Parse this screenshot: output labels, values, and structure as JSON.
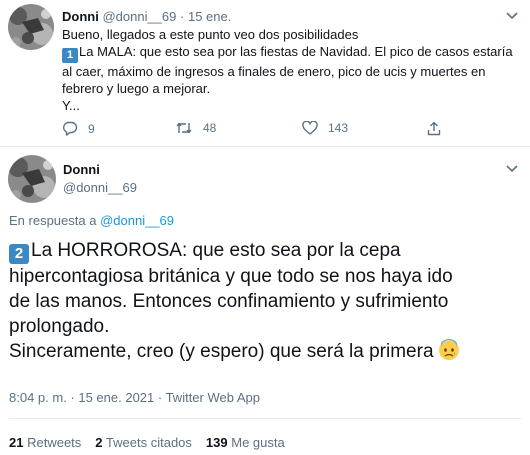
{
  "tweet1": {
    "author_name": "Donni",
    "handle": "@donni__69",
    "separator": "·",
    "date": "15 ene.",
    "lines": [
      "Bueno, llegados a este punto veo dos posibilidades",
      "La MALA: que esto sea por las fiestas de Navidad. El pico de casos estaría",
      "al caer, máximo de ingresos a finales de enero, pico de ucis y muertes en",
      "febrero y luego a mejorar.",
      "Y..."
    ],
    "keycap": "1",
    "replies": "9",
    "retweets": "48",
    "likes": "143"
  },
  "tweet2": {
    "author_name": "Donni",
    "handle": "@donni__69",
    "reply_prefix": "En respuesta a",
    "reply_to": "@donni__69",
    "keycap": "2",
    "lines": [
      "La HORROROSA: que esto sea por la cepa",
      "hipercontagiosa británica y que todo se nos haya ido",
      "de las manos. Entonces confinamiento y sufrimiento",
      "prolongado.",
      "Sinceramente, creo (y espero) que será la primera"
    ],
    "emoji": "anxious-face",
    "timestamp": "8:04 p. m. · 15 ene. 2021 · Twitter Web App",
    "stats": {
      "retweets_count": "21",
      "retweets_label": "Retweets",
      "quotes_count": "2",
      "quotes_label": "Tweets citados",
      "likes_count": "139",
      "likes_label": "Me gusta"
    }
  },
  "colors": {
    "text": "#0f1419",
    "secondary": "#5b7083",
    "link": "#1b95e0",
    "divider": "#e6ecf0",
    "keycap": "#3b88c3"
  }
}
